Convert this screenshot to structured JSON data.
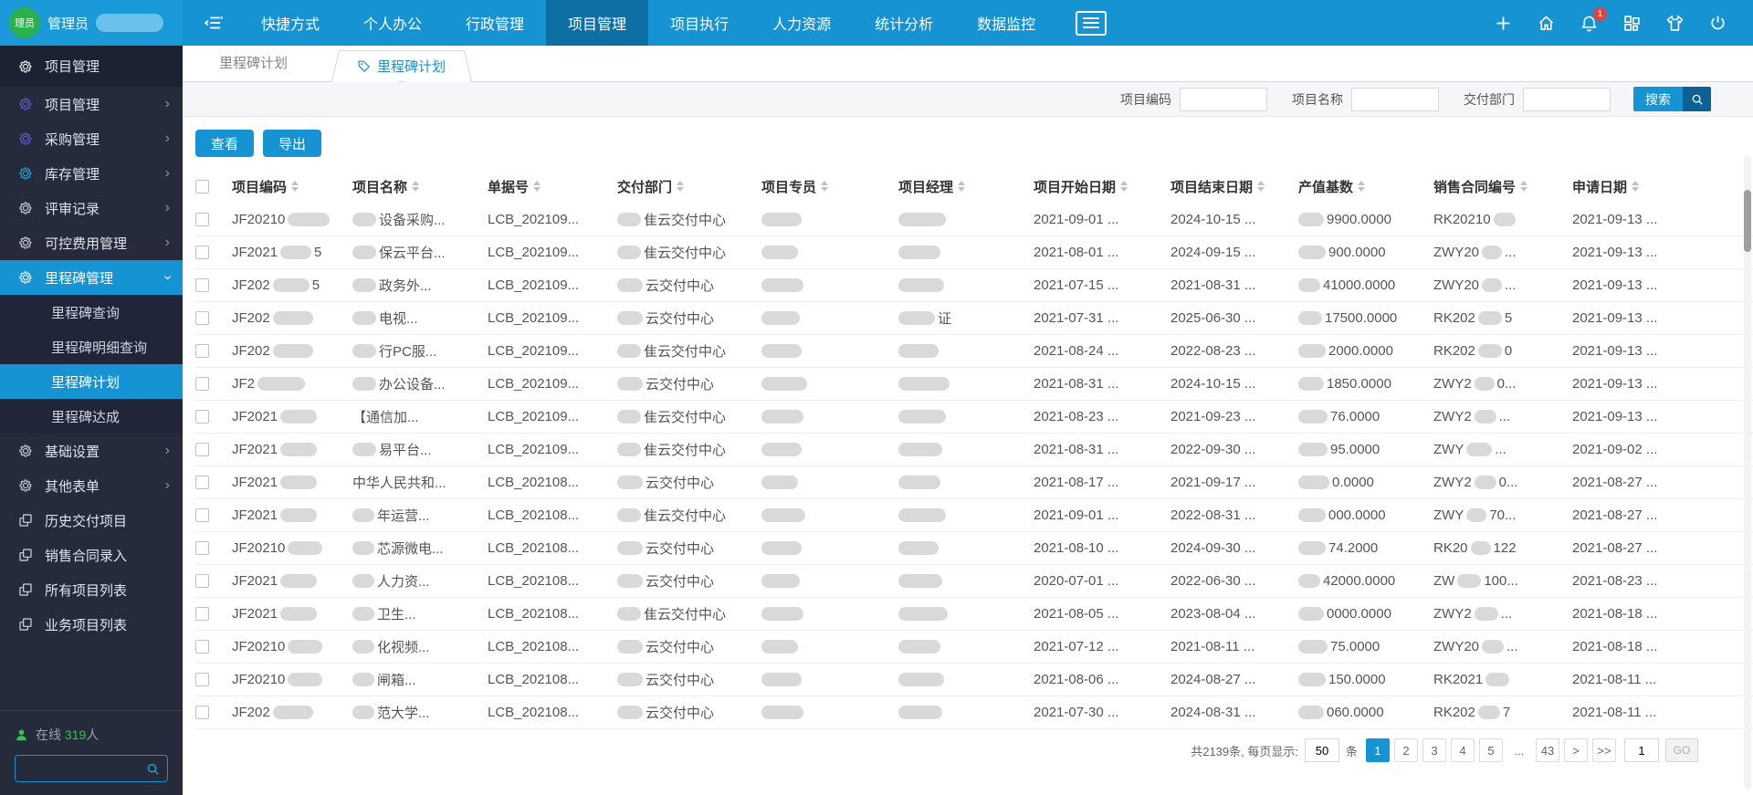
{
  "colors": {
    "accent": "#1593d2",
    "nav_active": "#0d6fa4",
    "sidebar_bg": "#252b3b",
    "sidebar_dark": "#1d2232",
    "selected_blue": "#1593d2",
    "online_green": "#35c258",
    "badge_red": "#e8413c",
    "gear_purple": "#6a5ad1",
    "gear_blue": "#29a3e3"
  },
  "topbar": {
    "avatar_label": "理员",
    "username": "管理员",
    "badge_count": "1",
    "nav_items": [
      {
        "label": "快捷方式",
        "active": false
      },
      {
        "label": "个人办公",
        "active": false
      },
      {
        "label": "行政管理",
        "active": false
      },
      {
        "label": "项目管理",
        "active": true
      },
      {
        "label": "项目执行",
        "active": false
      },
      {
        "label": "人力资源",
        "active": false
      },
      {
        "label": "统计分析",
        "active": false
      },
      {
        "label": "数据监控",
        "active": false
      }
    ],
    "icons": [
      "plus-icon",
      "home-icon",
      "bell-icon",
      "grid-icon",
      "shirt-icon",
      "power-icon"
    ]
  },
  "sidebar": {
    "items": [
      {
        "label": "项目管理",
        "icon": "gear",
        "icon_color": "#ffffff",
        "header": true
      },
      {
        "label": "项目管理",
        "icon": "gear",
        "icon_color": "#6a5ad1",
        "chevron": "right"
      },
      {
        "label": "采购管理",
        "icon": "gear",
        "icon_color": "#6a5ad1",
        "chevron": "right"
      },
      {
        "label": "库存管理",
        "icon": "gear",
        "icon_color": "#29a3e3",
        "chevron": "right"
      },
      {
        "label": "评审记录",
        "icon": "gear",
        "icon_color": "#cfd5e3",
        "chevron": "right"
      },
      {
        "label": "可控费用管理",
        "icon": "gear",
        "icon_color": "#cfd5e3",
        "chevron": "right"
      },
      {
        "label": "里程碑管理",
        "icon": "gear",
        "icon_color": "#ffffff",
        "chevron": "down",
        "active": true
      },
      {
        "label": "里程碑查询",
        "sub": true
      },
      {
        "label": "里程碑明细查询",
        "sub": true
      },
      {
        "label": "里程碑计划",
        "sub": true,
        "active": true
      },
      {
        "label": "里程碑达成",
        "sub": true
      },
      {
        "label": "基础设置",
        "icon": "gear",
        "icon_color": "#cfd5e3",
        "chevron": "right"
      },
      {
        "label": "其他表单",
        "icon": "gear",
        "icon_color": "#cfd5e3",
        "chevron": "right"
      },
      {
        "label": "历史交付项目",
        "icon": "pages",
        "icon_color": "#cfd5e3"
      },
      {
        "label": "销售合同录入",
        "icon": "pages",
        "icon_color": "#cfd5e3"
      },
      {
        "label": "所有项目列表",
        "icon": "pages",
        "icon_color": "#cfd5e3"
      },
      {
        "label": "业务项目列表",
        "icon": "pages",
        "icon_color": "#cfd5e3"
      }
    ],
    "online": {
      "label": "在线",
      "count": "319",
      "suffix": "人"
    },
    "search_value": ""
  },
  "tabs": {
    "crumb": "里程碑计划",
    "active": "里程碑计划"
  },
  "filters": {
    "fields": [
      {
        "label": "项目编码",
        "value": ""
      },
      {
        "label": "项目名称",
        "value": ""
      },
      {
        "label": "交付部门",
        "value": ""
      }
    ],
    "search_label": "搜索"
  },
  "toolbar": {
    "view_label": "查看",
    "export_label": "导出"
  },
  "table": {
    "redaction_note": "numeric segments are pixel widths of gray redaction blurs",
    "columns": [
      "项目编码",
      "项目名称",
      "单据号",
      "交付部门",
      "项目专员",
      "项目经理",
      "项目开始日期",
      "项目结束日期",
      "产值基数",
      "销售合同编号",
      "申请日期"
    ],
    "rows": [
      [
        [
          "JF20210",
          46
        ],
        [
          26,
          "设备采购..."
        ],
        [
          "LCB_202109..."
        ],
        [
          26,
          "隹云交付中心"
        ],
        [
          44
        ],
        [
          52
        ],
        [
          "2021-09-01 ..."
        ],
        [
          "2024-10-15 ..."
        ],
        [
          28,
          "9900.0000"
        ],
        [
          "RK20210",
          24
        ],
        [
          "2021-09-13 ..."
        ]
      ],
      [
        [
          "JF2021",
          34,
          "5"
        ],
        [
          26,
          "保云平台..."
        ],
        [
          "LCB_202109..."
        ],
        [
          26,
          "隹云交付中心"
        ],
        [
          40
        ],
        [
          46
        ],
        [
          "2021-08-01 ..."
        ],
        [
          "2024-09-15 ..."
        ],
        [
          30,
          "900.0000"
        ],
        [
          "ZWY20",
          22,
          "..."
        ],
        [
          "2021-09-13 ..."
        ]
      ],
      [
        [
          "JF202",
          40,
          "5"
        ],
        [
          26,
          "政务外..."
        ],
        [
          "LCB_202109..."
        ],
        [
          28,
          "云交付中心"
        ],
        [
          46
        ],
        [
          50
        ],
        [
          "2021-07-15 ..."
        ],
        [
          "2021-08-31 ..."
        ],
        [
          24,
          "41000.0000"
        ],
        [
          "ZWY20",
          22,
          "..."
        ],
        [
          "2021-09-13 ..."
        ]
      ],
      [
        [
          "JF202",
          44
        ],
        [
          26,
          "电视..."
        ],
        [
          "LCB_202109..."
        ],
        [
          28,
          "云交付中心"
        ],
        [
          42
        ],
        [
          40,
          "证"
        ],
        [
          "2021-07-31 ..."
        ],
        [
          "2025-06-30 ..."
        ],
        [
          26,
          "17500.0000"
        ],
        [
          "RK202",
          26,
          "5"
        ],
        [
          "2021-09-13 ..."
        ]
      ],
      [
        [
          "JF202",
          44
        ],
        [
          26,
          "行PC服..."
        ],
        [
          "LCB_202109..."
        ],
        [
          26,
          "隹云交付中心"
        ],
        [
          44
        ],
        [
          44
        ],
        [
          "2021-08-24 ..."
        ],
        [
          "2022-08-23 ..."
        ],
        [
          30,
          "2000.0000"
        ],
        [
          "RK202",
          26,
          "0"
        ],
        [
          "2021-09-13 ..."
        ]
      ],
      [
        [
          "JF2",
          52
        ],
        [
          26,
          "办公设备..."
        ],
        [
          "LCB_202109..."
        ],
        [
          28,
          "云交付中心"
        ],
        [
          50
        ],
        [
          56
        ],
        [
          "2021-08-31 ..."
        ],
        [
          "2024-10-15 ..."
        ],
        [
          28,
          "1850.0000"
        ],
        [
          "ZWY2",
          22,
          "0..."
        ],
        [
          "2021-09-13 ..."
        ]
      ],
      [
        [
          "JF2021",
          40
        ],
        [
          "【通信加..."
        ],
        [
          "LCB_202109..."
        ],
        [
          26,
          "隹云交付中心"
        ],
        [
          46
        ],
        [
          52
        ],
        [
          "2021-08-23 ..."
        ],
        [
          "2021-09-23 ..."
        ],
        [
          32,
          "76.0000"
        ],
        [
          "ZWY2",
          24,
          "..."
        ],
        [
          "2021-09-13 ..."
        ]
      ],
      [
        [
          "JF2021",
          40
        ],
        [
          26,
          "易平台..."
        ],
        [
          "LCB_202109..."
        ],
        [
          26,
          "隹云交付中心"
        ],
        [
          44
        ],
        [
          48
        ],
        [
          "2021-08-31 ..."
        ],
        [
          "2022-09-30 ..."
        ],
        [
          32,
          "95.0000"
        ],
        [
          "ZWY",
          28,
          "..."
        ],
        [
          "2021-09-02 ..."
        ]
      ],
      [
        [
          "JF2021",
          40
        ],
        [
          "中华人民共和..."
        ],
        [
          "LCB_202108..."
        ],
        [
          28,
          "云交付中心"
        ],
        [
          40
        ],
        [
          46
        ],
        [
          "2021-08-17 ..."
        ],
        [
          "2021-09-17 ..."
        ],
        [
          34,
          "0.0000"
        ],
        [
          "ZWY2",
          24,
          "0..."
        ],
        [
          "2021-08-27 ..."
        ]
      ],
      [
        [
          "JF2021",
          40
        ],
        [
          24,
          "年运营..."
        ],
        [
          "LCB_202108..."
        ],
        [
          26,
          "隹云交付中心"
        ],
        [
          48
        ],
        [
          52
        ],
        [
          "2021-09-01 ..."
        ],
        [
          "2022-08-31 ..."
        ],
        [
          30,
          "000.0000"
        ],
        [
          "ZWY",
          22,
          "70..."
        ],
        [
          "2021-08-27 ..."
        ]
      ],
      [
        [
          "JF20210",
          38
        ],
        [
          24,
          "芯源微电..."
        ],
        [
          "LCB_202108..."
        ],
        [
          28,
          "云交付中心"
        ],
        [
          44
        ],
        [
          44
        ],
        [
          "2021-08-10 ..."
        ],
        [
          "2024-09-30 ..."
        ],
        [
          30,
          "74.2000"
        ],
        [
          "RK20",
          22,
          "122"
        ],
        [
          "2021-08-27 ..."
        ]
      ],
      [
        [
          "JF2021",
          40
        ],
        [
          24,
          "人力资..."
        ],
        [
          "LCB_202108..."
        ],
        [
          28,
          "云交付中心"
        ],
        [
          42
        ],
        [
          48
        ],
        [
          "2020-07-01 ..."
        ],
        [
          "2022-06-30 ..."
        ],
        [
          24,
          "42000.0000"
        ],
        [
          "ZW",
          26,
          "100..."
        ],
        [
          "2021-08-23 ..."
        ]
      ],
      [
        [
          "JF2021",
          40
        ],
        [
          24,
          "卫生..."
        ],
        [
          "LCB_202108..."
        ],
        [
          26,
          "隹云交付中心"
        ],
        [
          46
        ],
        [
          54
        ],
        [
          "2021-08-05 ..."
        ],
        [
          "2023-08-04 ..."
        ],
        [
          28,
          "0000.0000"
        ],
        [
          "ZWY2",
          26,
          "..."
        ],
        [
          "2021-08-18 ..."
        ]
      ],
      [
        [
          "JF20210",
          38
        ],
        [
          24,
          "化视频..."
        ],
        [
          "LCB_202108..."
        ],
        [
          28,
          "云交付中心"
        ],
        [
          40
        ],
        [
          46
        ],
        [
          "2021-07-12 ..."
        ],
        [
          "2021-08-11 ..."
        ],
        [
          32,
          "75.0000"
        ],
        [
          "ZWY20",
          24,
          "..."
        ],
        [
          "2021-08-18 ..."
        ]
      ],
      [
        [
          "JF20210",
          38
        ],
        [
          24,
          "闸箱..."
        ],
        [
          "LCB_202108..."
        ],
        [
          28,
          "云交付中心"
        ],
        [
          44
        ],
        [
          50
        ],
        [
          "2021-08-06 ..."
        ],
        [
          "2024-08-27 ..."
        ],
        [
          30,
          "150.0000"
        ],
        [
          "RK2021",
          26
        ],
        [
          "2021-08-11 ..."
        ]
      ],
      [
        [
          "JF202",
          44
        ],
        [
          24,
          "范大学..."
        ],
        [
          "LCB_202108..."
        ],
        [
          28,
          "云交付中心"
        ],
        [
          46
        ],
        [
          48
        ],
        [
          "2021-07-30 ..."
        ],
        [
          "2024-08-31 ..."
        ],
        [
          28,
          "060.0000"
        ],
        [
          "RK202",
          24,
          "7"
        ],
        [
          "2021-08-11 ..."
        ]
      ]
    ]
  },
  "pagination": {
    "total_text": "共2139条, 每页显示:",
    "size": "50",
    "unit": "条",
    "pages": [
      "1",
      "2",
      "3",
      "4",
      "5",
      "...",
      "43",
      ">",
      ">>"
    ],
    "active": "1",
    "goto": "1",
    "go_label": "GO"
  }
}
